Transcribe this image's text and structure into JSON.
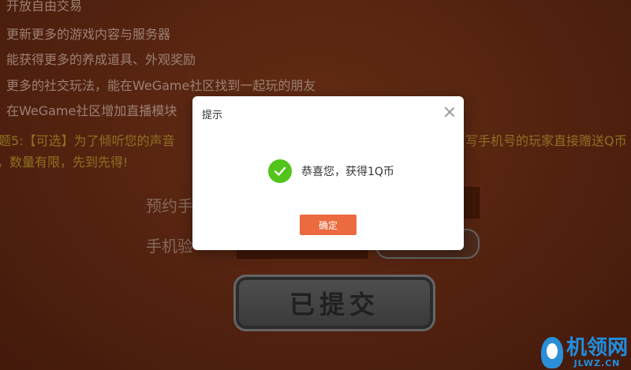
{
  "background": {
    "lines": [
      "开放自由交易",
      "更新更多的游戏内容与服务器",
      "能获得更多的养成道具、外观奖励",
      "更多的社交玩法，能在WeGame社区找到一起玩的朋友",
      "在WeGame社区增加直播模块"
    ],
    "question5_head": "题5:【可选】为了倾听您的声音",
    "question5_tail": "写手机号的玩家直接赠送Q币",
    "question5_line2": "，数量有限，先到先得!",
    "phone_label": "预约手",
    "code_label": "手机验",
    "submit_label": "已提交"
  },
  "modal": {
    "title": "提示",
    "message": "恭喜您，获得1Q币",
    "ok_label": "确定"
  },
  "watermark": {
    "title": "机领网",
    "subtitle": "JLWZ.CN"
  },
  "colors": {
    "accent": "#ec6a3f",
    "success": "#52c41a",
    "gold_text": "#c79a2e"
  }
}
